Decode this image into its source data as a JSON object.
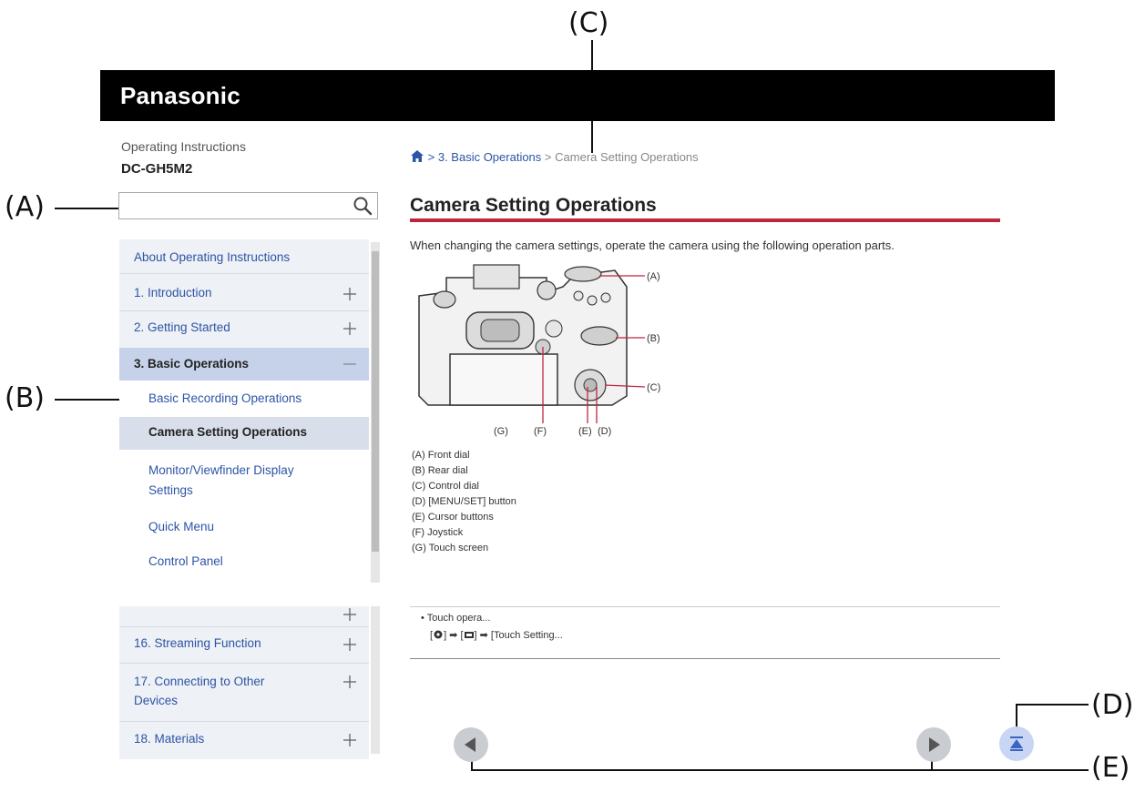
{
  "callouts": {
    "A": "(A)",
    "B": "(B)",
    "C": "(C)",
    "D": "(D)",
    "E": "(E)"
  },
  "header": {
    "logo": "Panasonic"
  },
  "doc": {
    "type": "Operating Instructions",
    "model": "DC-GH5M2"
  },
  "search": {
    "placeholder": "",
    "value": ""
  },
  "sidebar": {
    "items": [
      {
        "label": "About Operating Instructions",
        "icon": ""
      },
      {
        "label": "1. Introduction",
        "icon": "plus-icon"
      },
      {
        "label": "2. Getting Started",
        "icon": "plus-icon"
      },
      {
        "label": "3. Basic Operations",
        "icon": "minus-icon"
      }
    ],
    "sub_items": [
      {
        "label": "Basic Recording Operations"
      },
      {
        "label": "Camera Setting Operations"
      },
      {
        "label": "Monitor/Viewfinder Display Settings"
      },
      {
        "label": "Quick Menu"
      },
      {
        "label": "Control Panel"
      }
    ],
    "bottom_items": [
      {
        "label": "16. Streaming Function",
        "icon": "plus-icon"
      },
      {
        "label": "17. Connecting to Other Devices",
        "icon": "plus-icon"
      },
      {
        "label": "18. Materials",
        "icon": "plus-icon"
      }
    ]
  },
  "breadcrumb": {
    "sep": ">",
    "parent": "3. Basic Operations",
    "current": "Camera Setting Operations"
  },
  "main": {
    "title": "Camera Setting Operations",
    "intro": "When changing the camera settings, operate the camera using the following operation parts.",
    "figure_labels": {
      "A": "(A)",
      "B": "(B)",
      "C": "(C)",
      "D": "(D)",
      "E": "(E)",
      "F": "(F)",
      "G": "(G)"
    },
    "legend": [
      "(A) Front dial",
      "(B) Rear dial",
      "(C) Control dial",
      "(D) [MENU/SET] button",
      "(E) Cursor buttons",
      "(F) Joystick",
      "(G) Touch screen"
    ],
    "note_line1": "• Touch opera...",
    "note_line2_a": "[",
    "note_line2_b": "] ➡ [",
    "note_line2_c": "] ➡ [Touch Setting..."
  },
  "colors": {
    "header_bg": "#000000",
    "title_rule": "#c0263b",
    "link": "#2d54a6",
    "sidebar_bg": "#eef1f5",
    "active_bg": "#c6d2ea"
  }
}
